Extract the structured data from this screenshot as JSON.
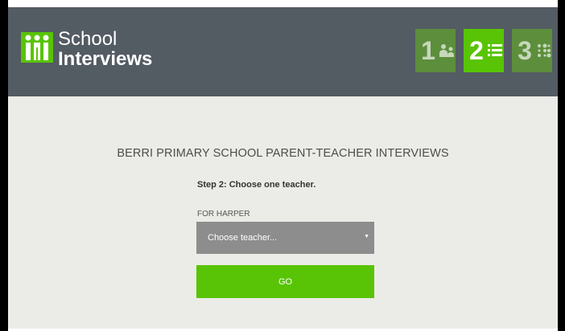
{
  "header": {
    "logo": {
      "line1": "School",
      "line2": "Interviews",
      "icon": "three-people-icon"
    },
    "steps": [
      {
        "number": "1",
        "icon": "people-icon",
        "state": "completed"
      },
      {
        "number": "2",
        "icon": "list-icon",
        "state": "active"
      },
      {
        "number": "3",
        "icon": "schedule-dots-icon",
        "state": "upcoming"
      }
    ]
  },
  "main": {
    "title": "BERRI PRIMARY SCHOOL PARENT-TEACHER INTERVIEWS",
    "step_heading": "Step 2: Choose one teacher.",
    "for_label": "FOR HARPER",
    "teacher_select": {
      "value": "Choose teacher...",
      "arrow": "▼"
    },
    "go_label": "GO"
  },
  "colors": {
    "header_bg": "#535b63",
    "accent_green": "#58c405",
    "select_bg": "#8d8d8d",
    "page_bg": "#ebebe7"
  }
}
